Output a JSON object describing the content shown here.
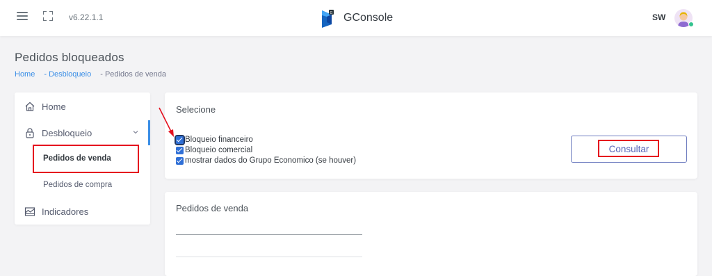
{
  "header": {
    "version": "v6.22.1.1",
    "brand": "GConsole",
    "user_initials": "SW",
    "accent": "#3a8ee6",
    "online_color": "#34c38f"
  },
  "page": {
    "title": "Pedidos bloqueados",
    "breadcrumb": [
      {
        "label": "Home"
      },
      {
        "label": "- Desbloqueio"
      },
      {
        "label": "- Pedidos de venda"
      }
    ]
  },
  "sidebar": {
    "items": [
      {
        "label": "Home",
        "icon": "home-icon"
      },
      {
        "label": "Desbloqueio",
        "icon": "lock-icon"
      },
      {
        "label": "Pedidos de venda"
      },
      {
        "label": "Pedidos de compra"
      },
      {
        "label": "Indicadores",
        "icon": "chart-icon"
      }
    ]
  },
  "selecione": {
    "title": "Selecione",
    "checkboxes": [
      {
        "label": "Bloqueio financeiro",
        "checked": true
      },
      {
        "label": "Bloqueio comercial",
        "checked": true
      },
      {
        "label": "mostrar dados do Grupo Economico (se houver)",
        "checked": true
      }
    ],
    "button_label": "Consultar"
  },
  "pedidos": {
    "title": "Pedidos de venda"
  },
  "annotations": {
    "highlight_color": "#e5101e"
  }
}
